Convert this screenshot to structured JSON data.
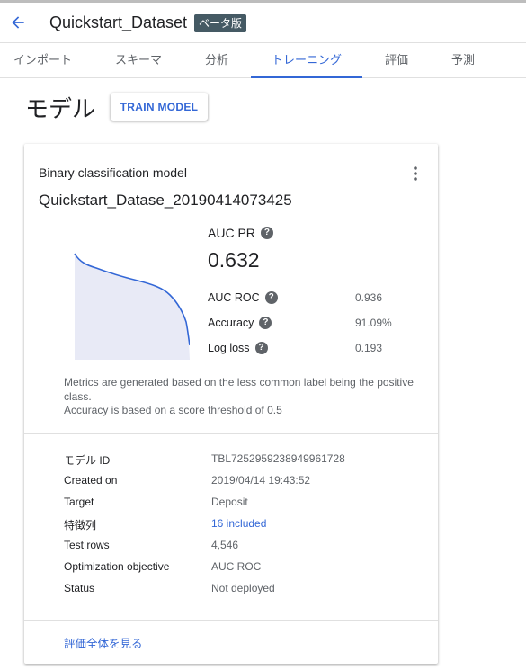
{
  "header": {
    "title": "Quickstart_Dataset",
    "badge": "ベータ版"
  },
  "tabs": [
    {
      "label": "インポート"
    },
    {
      "label": "スキーマ"
    },
    {
      "label": "分析"
    },
    {
      "label": "トレーニング"
    },
    {
      "label": "評価"
    },
    {
      "label": "予測"
    }
  ],
  "active_tab": "トレーニング",
  "page": {
    "heading": "モデル",
    "train_button": "TRAIN MODEL"
  },
  "card": {
    "model_type": "Binary classification model",
    "model_name": "Quickstart_Datase_20190414073425",
    "auc_pr_label": "AUC PR",
    "auc_pr_value": "0.632",
    "metrics": [
      {
        "label": "AUC ROC",
        "value": "0.936"
      },
      {
        "label": "Accuracy",
        "value": "91.09%"
      },
      {
        "label": "Log loss",
        "value": "0.193"
      }
    ],
    "note_line1": "Metrics are generated based on the less common label being the positive class.",
    "note_line2": "Accuracy is based on a score threshold of 0.5",
    "details": [
      {
        "label": "モデル ID",
        "value": "TBL7252959238949961728"
      },
      {
        "label": "Created on",
        "value": "2019/04/14 19:43:52"
      },
      {
        "label": "Target",
        "value": "Deposit"
      },
      {
        "label": "特徴列",
        "value": "16 included"
      },
      {
        "label": "Test rows",
        "value": "4,546"
      },
      {
        "label": "Optimization objective",
        "value": "AUC ROC"
      },
      {
        "label": "Status",
        "value": "Not deployed"
      }
    ],
    "eval_link": "評価全体を見る"
  },
  "colors": {
    "accent": "#3367d6",
    "badge_bg": "#455a64",
    "curve_fill": "#e8eaf6"
  },
  "icons": {
    "back": "arrow-back-icon",
    "menu": "more-vert-icon",
    "help": "help-circle-icon"
  }
}
